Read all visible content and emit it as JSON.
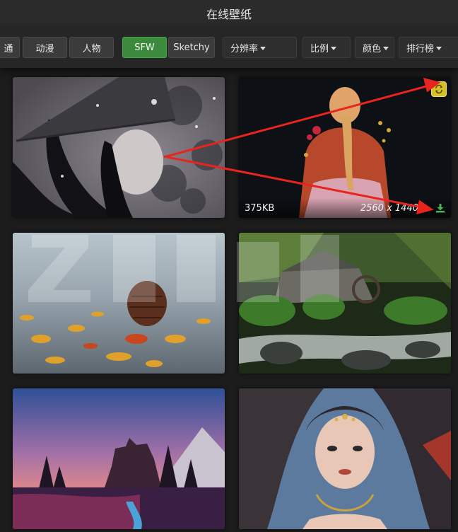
{
  "window": {
    "title": "在线壁纸"
  },
  "toolbar": {
    "category_tabs": [
      "通",
      "动漫",
      "人物"
    ],
    "purity": {
      "sfw_label": "SFW",
      "sketchy_label": "Sketchy"
    },
    "filters": {
      "resolution_label": "分辨率",
      "ratio_label": "比例",
      "color_label": "颜色",
      "sort_label": "排行榜"
    }
  },
  "wallpapers": [
    {
      "subject": "girl with conical straw hat in snow"
    },
    {
      "subject": "red-haired girl with long braid",
      "size": "375KB",
      "resolution": "2560 x 1440",
      "hovered": true
    },
    {
      "subject": "pinecone on autumn leaves"
    },
    {
      "subject": "mossy stone mill by a stream"
    },
    {
      "subject": "castle on hill at pink sunset"
    },
    {
      "subject": "portrait of girl with jeweled headdress"
    }
  ],
  "colors": {
    "sfw_active": "#3c8a3c",
    "sync_badge": "#d7c12a",
    "download_icon": "#4caf50",
    "annotation_arrow": "#e8241c"
  },
  "icons": {
    "sync": "sync-icon",
    "download": "download-icon",
    "caret": "caret-down-icon"
  }
}
